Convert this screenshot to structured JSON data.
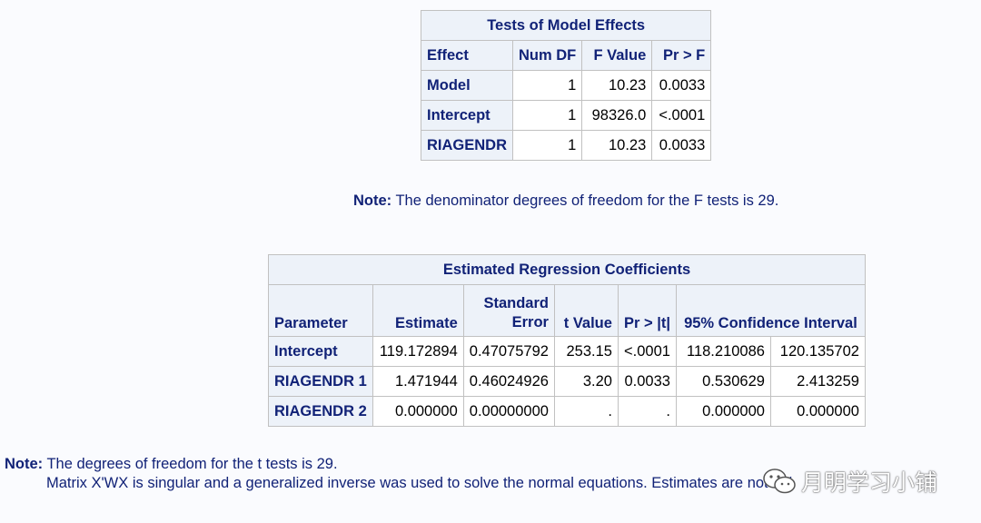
{
  "model_effects": {
    "title": "Tests of Model Effects",
    "headers": [
      "Effect",
      "Num DF",
      "F Value",
      "Pr > F"
    ],
    "rows": [
      {
        "effect": "Model",
        "num_df": "1",
        "f_value": "10.23",
        "pr_f": "0.0033"
      },
      {
        "effect": "Intercept",
        "num_df": "1",
        "f_value": "98326.0",
        "pr_f": "<.0001"
      },
      {
        "effect": "RIAGENDR",
        "num_df": "1",
        "f_value": "10.23",
        "pr_f": "0.0033"
      }
    ]
  },
  "note1": {
    "label": "Note:",
    "text": "The denominator degrees of freedom for the F tests is 29."
  },
  "coefficients": {
    "title": "Estimated Regression Coefficients",
    "headers": {
      "parameter": "Parameter",
      "estimate": "Estimate",
      "std_error_line1": "Standard",
      "std_error_line2": "Error",
      "t_value": "t Value",
      "pr_t": "Pr > |t|",
      "ci": "95% Confidence Interval"
    },
    "rows": [
      {
        "parameter": "Intercept",
        "estimate": "119.172894",
        "std_error": "0.47075792",
        "t_value": "253.15",
        "pr_t": "<.0001",
        "ci_low": "118.210086",
        "ci_high": "120.135702"
      },
      {
        "parameter": "RIAGENDR 1",
        "estimate": "1.471944",
        "std_error": "0.46024926",
        "t_value": "3.20",
        "pr_t": "0.0033",
        "ci_low": "0.530629",
        "ci_high": "2.413259"
      },
      {
        "parameter": "RIAGENDR 2",
        "estimate": "0.000000",
        "std_error": "0.00000000",
        "t_value": ".",
        "pr_t": ".",
        "ci_low": "0.000000",
        "ci_high": "0.000000"
      }
    ]
  },
  "note2": {
    "label": "Note:",
    "line1": "The degrees of freedom for the t tests is 29.",
    "line2": "Matrix X'WX is singular and a generalized inverse was used to solve the normal equations. Estimates are not uni"
  },
  "watermark": {
    "text": "月明学习小铺",
    "icon": "wechat-icon"
  }
}
